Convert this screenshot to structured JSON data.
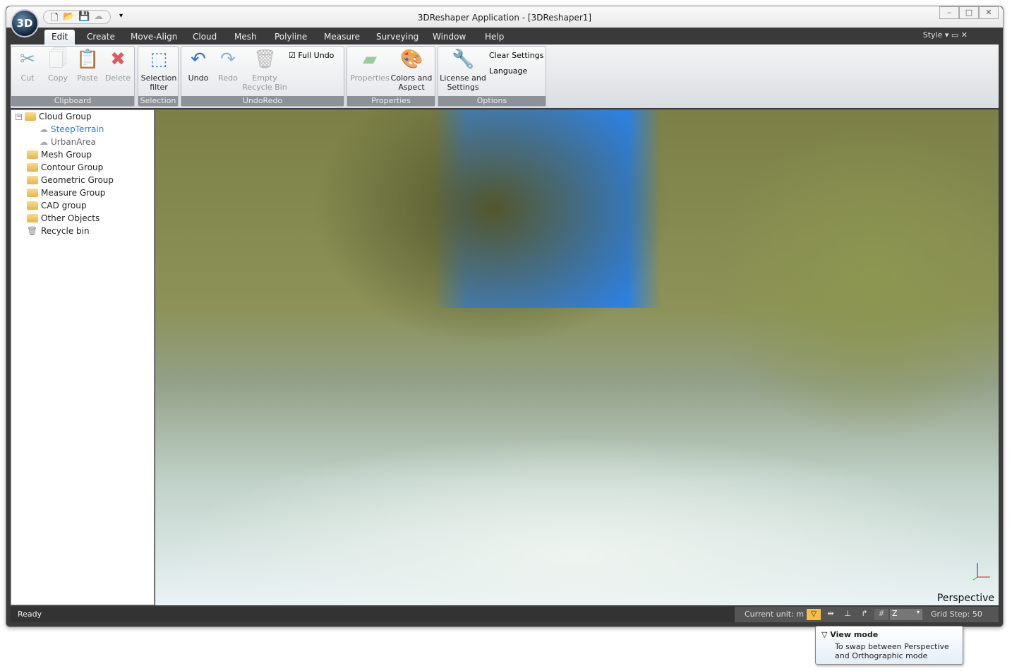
{
  "window": {
    "title": "3DReshaper Application - [3DReshaper1]",
    "logo": "3D",
    "style_label": "Style"
  },
  "quick_access": [
    "new-icon",
    "open-icon",
    "save-icon",
    "cloud-icon"
  ],
  "tabs": [
    "Edit",
    "Create",
    "Move-Align",
    "Cloud",
    "Mesh",
    "Polyline",
    "Measure",
    "Surveying",
    "Window",
    "Help"
  ],
  "ribbon": {
    "clipboard": {
      "label": "Clipboard",
      "cut": "Cut",
      "copy": "Copy",
      "paste": "Paste",
      "delete": "Delete"
    },
    "selection": {
      "label": "Selection",
      "filter": "Selection filter"
    },
    "undoredo": {
      "label": "UndoRedo",
      "undo": "Undo",
      "redo": "Redo",
      "empty": "Empty Recycle Bin",
      "full_undo": "Full Undo",
      "full_undo_checked": true
    },
    "properties": {
      "label": "Properties",
      "properties": "Properties",
      "colors": "Colors and Aspect"
    },
    "options": {
      "label": "Options",
      "license": "License and Settings",
      "clear": "Clear Settings",
      "language": "Language"
    }
  },
  "tree": [
    {
      "label": "Cloud Group",
      "type": "folder",
      "expanded": true
    },
    {
      "label": "SteepTerrain",
      "type": "cloud",
      "selected": true
    },
    {
      "label": "UrbanArea",
      "type": "cloud"
    },
    {
      "label": "Mesh Group",
      "type": "folder"
    },
    {
      "label": "Contour Group",
      "type": "folder"
    },
    {
      "label": "Geometric Group",
      "type": "folder"
    },
    {
      "label": "Measure Group",
      "type": "folder"
    },
    {
      "label": "CAD group",
      "type": "folder"
    },
    {
      "label": "Other Objects",
      "type": "folder"
    },
    {
      "label": "Recycle bin",
      "type": "trash"
    }
  ],
  "viewport": {
    "mode": "Perspective"
  },
  "status": {
    "text": "Ready",
    "unit": "Current unit: m",
    "axis": "Z",
    "grid_step": "Grid Step: 50"
  },
  "tooltip": {
    "title": "View mode",
    "body": "To swap between Perspective and Orthographic mode"
  }
}
